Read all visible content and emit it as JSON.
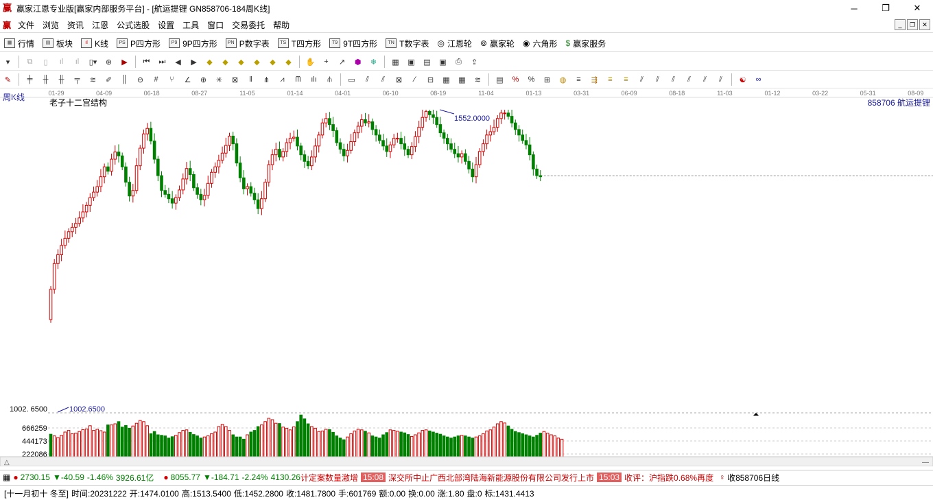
{
  "window": {
    "title": "赢家江恩专业版[赢家内部服务平台] - [航运提锂  GN858706-184周K线]",
    "controls": [
      "─",
      "❐",
      "✕"
    ]
  },
  "menu": [
    "文件",
    "浏览",
    "资讯",
    "江恩",
    "公式选股",
    "设置",
    "工具",
    "窗口",
    "交易委托",
    "帮助"
  ],
  "toolbar1": [
    {
      "icon": "grid-icon",
      "label": "行情"
    },
    {
      "icon": "block-icon",
      "label": "板块"
    },
    {
      "icon": "kline-icon",
      "label": "K线"
    },
    {
      "icon": "PS",
      "label": "P四方形"
    },
    {
      "icon": "P9",
      "label": "9P四方形"
    },
    {
      "icon": "PN",
      "label": "P数字表"
    },
    {
      "icon": "TS",
      "label": "T四方形"
    },
    {
      "icon": "T9",
      "label": "9T四方形"
    },
    {
      "icon": "TN",
      "label": "T数字表"
    },
    {
      "icon": "wheel-icon",
      "label": "江恩轮"
    },
    {
      "icon": "wheel-icon",
      "label": "赢家轮"
    },
    {
      "icon": "hex-icon",
      "label": "六角形"
    },
    {
      "icon": "dollar-icon",
      "label": "赢家服务"
    }
  ],
  "chart": {
    "period_label": "周K线",
    "indicator_name": "老子十二宫结构",
    "code_name": "858706  航运提锂",
    "date_ticks": [
      "01-29",
      "04-09",
      "06-18",
      "08-27",
      "11-05",
      "01-14",
      "04-01",
      "06-10",
      "08-19",
      "11-04",
      "01-13",
      "03-31",
      "06-09",
      "08-18",
      "11-03",
      "01-12",
      "03-22",
      "05-31",
      "08-09"
    ],
    "high_label": "1552.0000",
    "low_label": "1002.6500",
    "low_axis_label": "1002. 6500",
    "volume_ticks": [
      "666259",
      "444173",
      "222086"
    ],
    "current_price": 1431.4413,
    "price_range": [
      1002.65,
      1552.0
    ],
    "colors": {
      "up": "#d00000",
      "down": "#008000",
      "axis_text": "#1a1aa0"
    }
  },
  "chart_data": {
    "type": "candlestick",
    "closes": [
      1225,
      1272,
      1288,
      1305,
      1318,
      1330,
      1338,
      1345,
      1355,
      1366,
      1378,
      1392,
      1402,
      1412,
      1430,
      1448,
      1440,
      1462,
      1475,
      1468,
      1448,
      1420,
      1395,
      1405,
      1450,
      1482,
      1508,
      1518,
      1495,
      1462,
      1432,
      1405,
      1398,
      1390,
      1382,
      1392,
      1406,
      1426,
      1445,
      1434,
      1410,
      1398,
      1388,
      1396,
      1418,
      1438,
      1448,
      1460,
      1473,
      1487,
      1504,
      1490,
      1455,
      1428,
      1408,
      1412,
      1400,
      1388,
      1372,
      1390,
      1420,
      1452,
      1470,
      1480,
      1466,
      1476,
      1492,
      1500,
      1502,
      1486,
      1470,
      1458,
      1450,
      1466,
      1486,
      1506,
      1528,
      1536,
      1525,
      1514,
      1492,
      1480,
      1468,
      1478,
      1494,
      1510,
      1522,
      1534,
      1528,
      1530,
      1516,
      1506,
      1496,
      1486,
      1476,
      1488,
      1500,
      1500,
      1490,
      1480,
      1470,
      1485,
      1503,
      1520,
      1538,
      1549,
      1543,
      1538,
      1525,
      1510,
      1500,
      1490,
      1480,
      1472,
      1466,
      1472,
      1458,
      1444,
      1430,
      1452,
      1476,
      1490,
      1506,
      1512,
      1520,
      1536,
      1546,
      1546,
      1540,
      1528,
      1516,
      1506,
      1496,
      1488,
      1470,
      1444,
      1432,
      1430
    ],
    "volumes": [
      82,
      76,
      70,
      78,
      90,
      96,
      84,
      86,
      92,
      99,
      101,
      113,
      96,
      100,
      95,
      90,
      116,
      116,
      120,
      128,
      108,
      114,
      104,
      112,
      122,
      132,
      128,
      113,
      84,
      92,
      80,
      78,
      76,
      68,
      73,
      78,
      88,
      96,
      98,
      89,
      81,
      76,
      68,
      72,
      76,
      84,
      90,
      110,
      118,
      110,
      96,
      80,
      72,
      72,
      64,
      80,
      90,
      96,
      110,
      116,
      128,
      140,
      135,
      122,
      121,
      108,
      104,
      98,
      109,
      128,
      152,
      138,
      120,
      110,
      104,
      92,
      94,
      100,
      99,
      89,
      76,
      68,
      62,
      72,
      84,
      94,
      100,
      98,
      93,
      87,
      76,
      72,
      68,
      80,
      88,
      98,
      96,
      93,
      90,
      87,
      81,
      74,
      80,
      87,
      96,
      98,
      94,
      90,
      86,
      82,
      76,
      72,
      68,
      72,
      76,
      78,
      76,
      72,
      68,
      72,
      76,
      84,
      94,
      98,
      108,
      120,
      128,
      123,
      112,
      100,
      92,
      88,
      84,
      80,
      76,
      72,
      78,
      86,
      92,
      86,
      80,
      76,
      68,
      64
    ]
  },
  "status1": {
    "sh_price": "2730.15",
    "sh_change": "▼-40.59",
    "sh_pct": "-1.46%",
    "sh_amount": "3926.61亿",
    "sz_price": "8055.77",
    "sz_change": "▼-184.71",
    "sz_pct": "-2.24%",
    "sz_amount": "4130.26",
    "news1": "计定案数量激增",
    "time1": "15:08",
    "news2": "深交所中止广西北部湾陆海新能源股份有限公司发行上市",
    "time2": "15:03",
    "news3": "收评：沪指跌0.68%再度",
    "symbol_info": "收858706日线"
  },
  "status2": {
    "date": "[十一月初十 冬至]",
    "time": "时间:20231222",
    "open": "开:1474.0100",
    "high": "高:1513.5400",
    "low": "低:1452.2800",
    "close": "收:1481.7800",
    "hand": "手:601769",
    "amount": "额:0.00",
    "turnover": "换:0.00",
    "rise": "涨:1.80",
    "pan": "盘:0",
    "mark": "标:1431.4413"
  }
}
